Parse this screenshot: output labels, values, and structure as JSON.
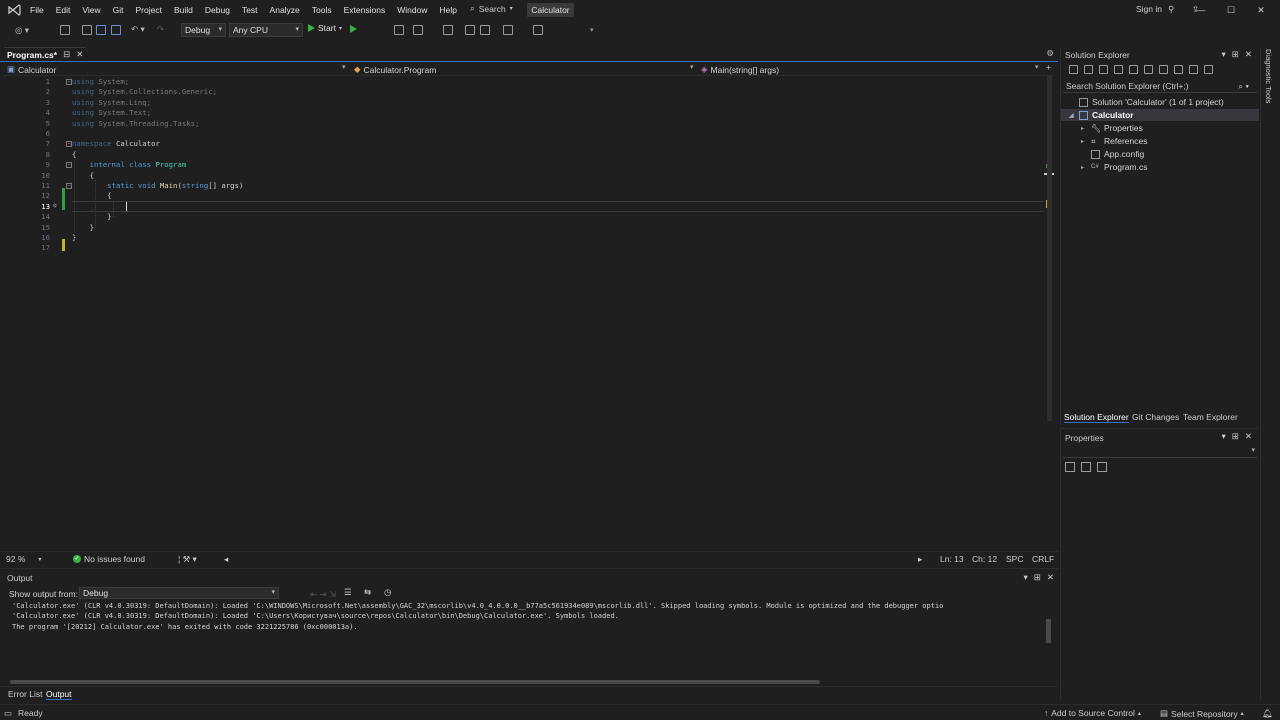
{
  "menubar": {
    "items": [
      "File",
      "Edit",
      "View",
      "Git",
      "Project",
      "Build",
      "Debug",
      "Test",
      "Analyze",
      "Tools",
      "Extensions",
      "Window",
      "Help"
    ],
    "search_label": "Search",
    "solution_name": "Calculator",
    "signin": "Sign in"
  },
  "toolbar": {
    "config": "Debug",
    "platform": "Any CPU",
    "start_label": "Start"
  },
  "tabs": {
    "active_tab": "Program.cs*"
  },
  "navbar": {
    "project": "Calculator",
    "class": "Calculator.Program",
    "member": "Main(string[] args)"
  },
  "editor": {
    "line_numbers": [
      "1",
      "2",
      "3",
      "4",
      "5",
      "6",
      "7",
      "8",
      "9",
      "10",
      "11",
      "12",
      "13",
      "14",
      "15",
      "16",
      "17"
    ],
    "lines": [
      {
        "parts": [
          [
            "kwd",
            "using"
          ],
          [
            "id",
            " System;"
          ]
        ]
      },
      {
        "parts": [
          [
            "kwd",
            "using"
          ],
          [
            "id",
            " System.Collections.Generic;"
          ]
        ]
      },
      {
        "parts": [
          [
            "kwd",
            "using"
          ],
          [
            "id",
            " System.Linq;"
          ]
        ]
      },
      {
        "parts": [
          [
            "kwd",
            "using"
          ],
          [
            "id",
            " System.Text;"
          ]
        ]
      },
      {
        "parts": [
          [
            "kwd",
            "using"
          ],
          [
            "id",
            " System.Threading.Tasks;"
          ]
        ]
      },
      {
        "parts": []
      },
      {
        "parts": [
          [
            "kwd",
            "namespace"
          ],
          [
            "nsn",
            " Calculator"
          ]
        ]
      },
      {
        "parts": [
          [
            "pl",
            "{"
          ]
        ]
      },
      {
        "parts": [
          [
            "pl",
            "    "
          ],
          [
            "kw",
            "internal class"
          ],
          [
            "ty",
            " Program"
          ]
        ]
      },
      {
        "parts": [
          [
            "pl",
            "    {"
          ]
        ]
      },
      {
        "parts": [
          [
            "pl",
            "        "
          ],
          [
            "kw",
            "static void"
          ],
          [
            "fn",
            " Main"
          ],
          [
            "pl",
            "("
          ],
          [
            "kw",
            "string"
          ],
          [
            "pl",
            "[] args)"
          ]
        ]
      },
      {
        "parts": [
          [
            "pl",
            "        {"
          ]
        ]
      },
      {
        "parts": [
          [
            "pl",
            "            "
          ]
        ]
      },
      {
        "parts": [
          [
            "pl",
            "        }"
          ]
        ]
      },
      {
        "parts": [
          [
            "pl",
            "    }"
          ]
        ]
      },
      {
        "parts": [
          [
            "pl",
            "}"
          ]
        ]
      },
      {
        "parts": []
      }
    ],
    "zoom": "92 %",
    "issues": "No issues found",
    "ln": "Ln: 13",
    "ch": "Ch: 12",
    "spc": "SPC",
    "eol": "CRLF"
  },
  "output": {
    "title": "Output",
    "show_from_label": "Show output from:",
    "show_from_value": "Debug",
    "lines": [
      "'Calculator.exe' (CLR v4.0.30319: DefaultDomain): Loaded 'C:\\WINDOWS\\Microsoft.Net\\assembly\\GAC_32\\mscorlib\\v4.0_4.0.0.0__b77a5c561934e089\\mscorlib.dll'. Skipped loading symbols. Module is optimized and the debugger optio",
      "'Calculator.exe' (CLR v4.0.30319: DefaultDomain): Loaded 'C:\\Users\\Користувач\\source\\repos\\Calculator\\bin\\Debug\\Calculator.exe'. Symbols loaded.",
      "The program '[20212] Calculator.exe' has exited with code 3221225786 (0xc000013a)."
    ]
  },
  "bottom_tabs": [
    "Error List",
    "Output"
  ],
  "solution_explorer": {
    "title": "Solution Explorer",
    "search_placeholder": "Search Solution Explorer (Ctrl+;)",
    "nodes": [
      {
        "label": "Solution 'Calculator' (1 of 1 project)"
      },
      {
        "label": "Calculator"
      },
      {
        "label": "Properties"
      },
      {
        "label": "References"
      },
      {
        "label": "App.config"
      },
      {
        "label": "Program.cs"
      }
    ],
    "tabs": [
      "Solution Explorer",
      "Git Changes",
      "Team Explorer"
    ]
  },
  "properties": {
    "title": "Properties"
  },
  "diagnostic_strip": "Diagnostic Tools",
  "statusbar": {
    "ready": "Ready",
    "add_source": "Add to Source Control",
    "select_repo": "Select Repository"
  }
}
